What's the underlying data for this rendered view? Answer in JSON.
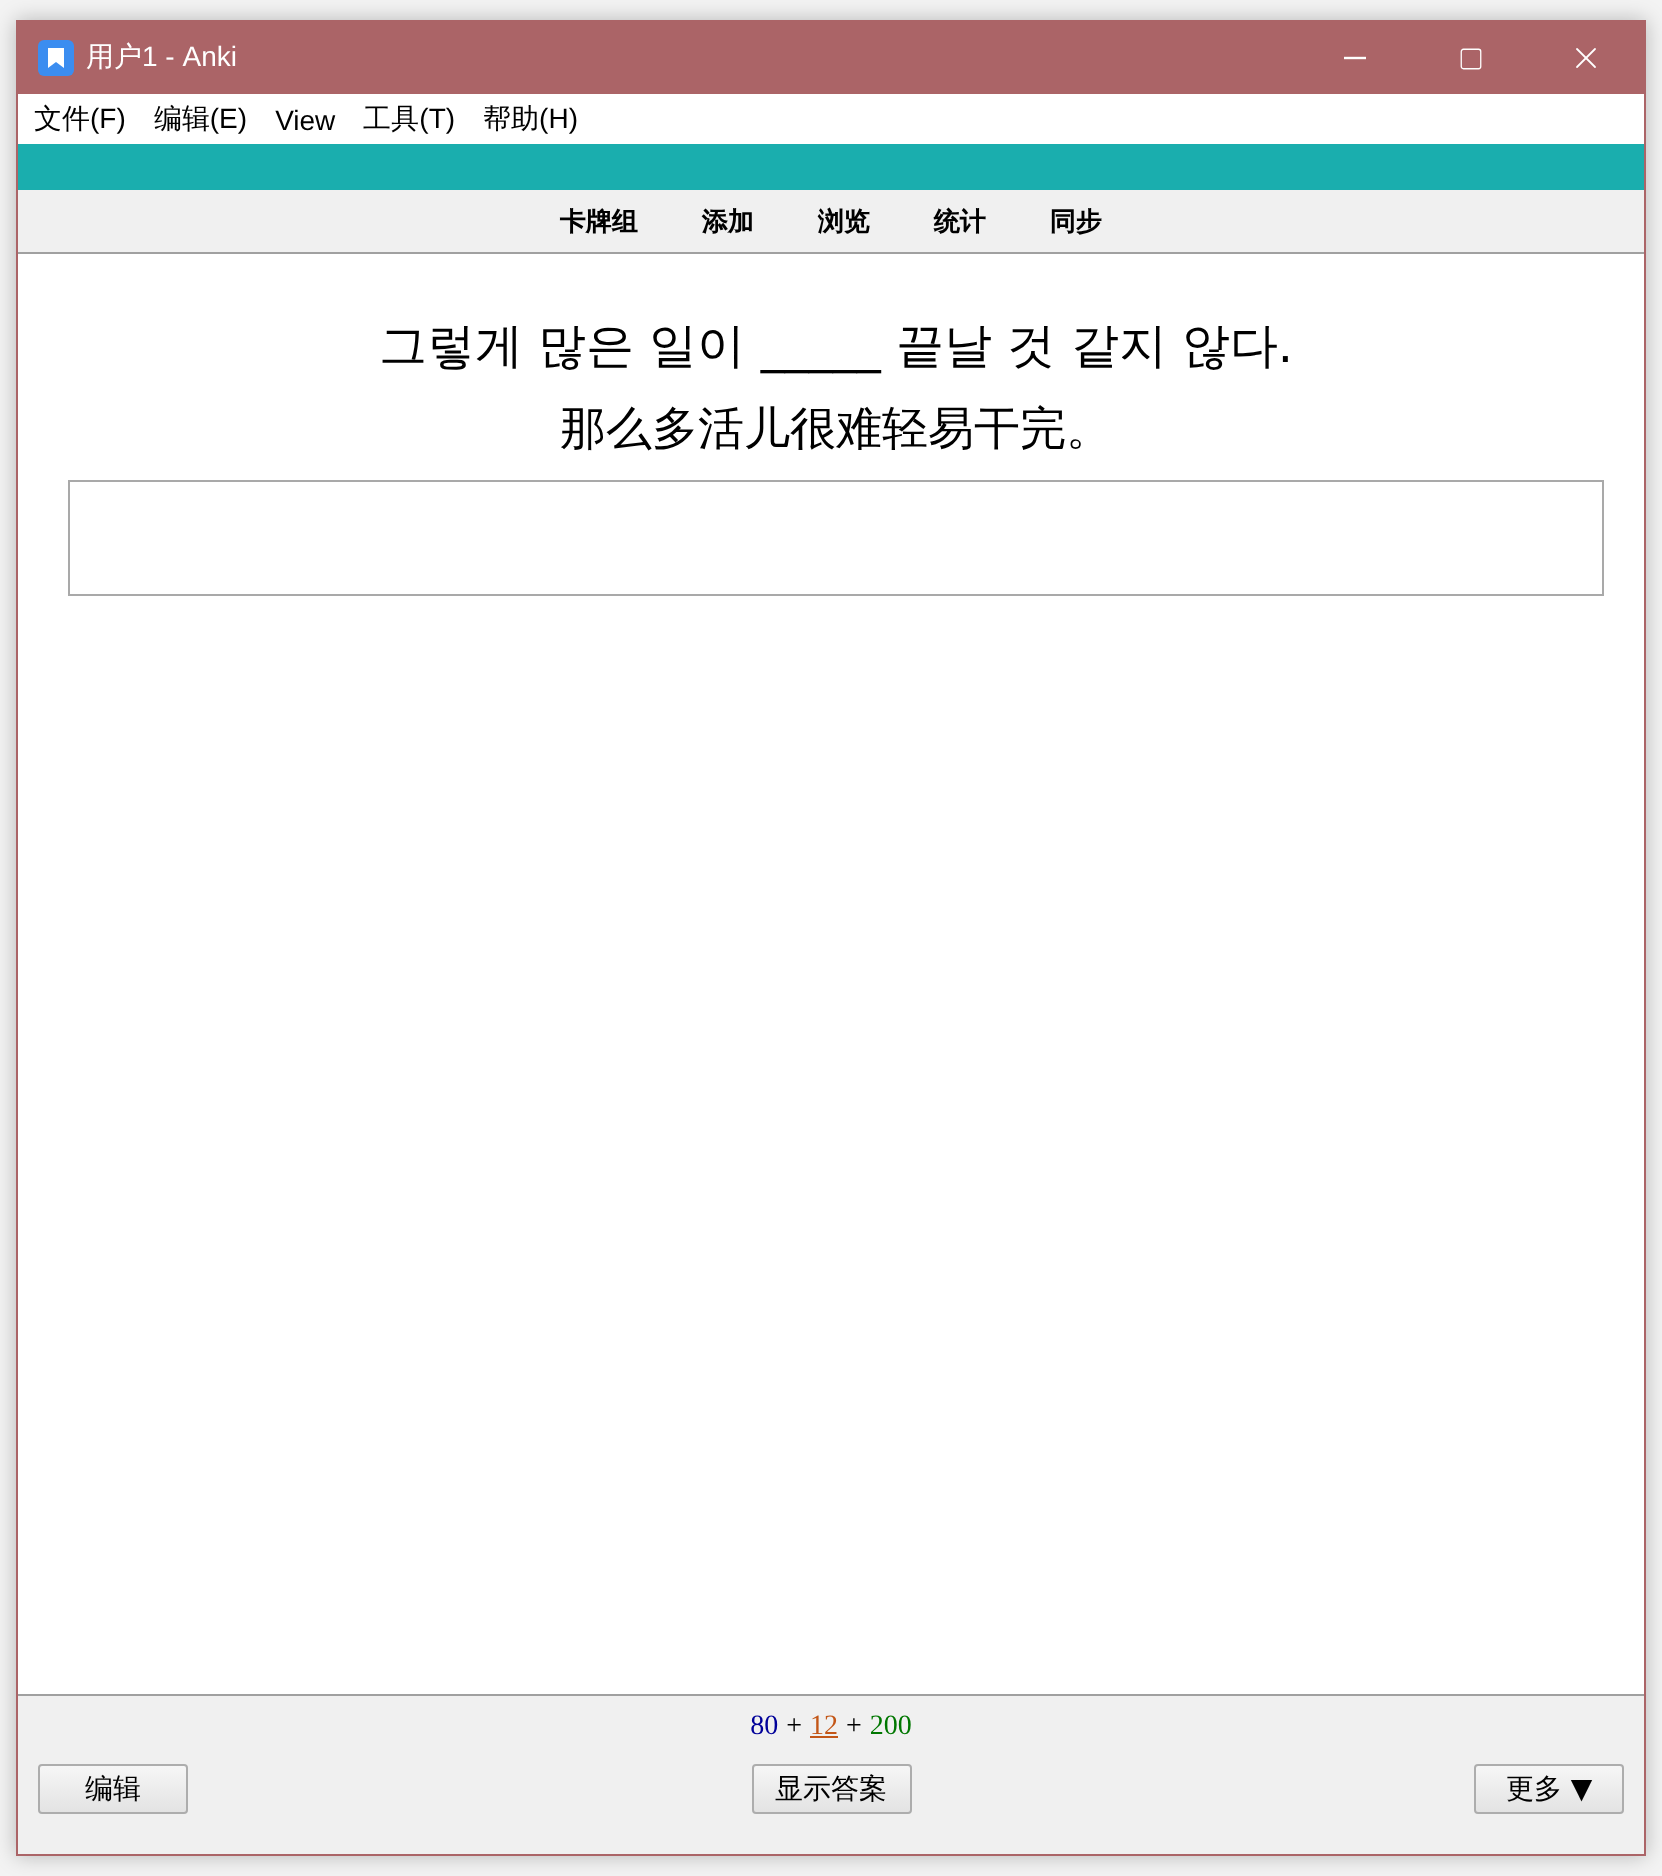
{
  "window": {
    "title": "用户1 - Anki"
  },
  "menu": [
    "文件(F)",
    "编辑(E)",
    "View",
    "工具(T)",
    "帮助(H)"
  ],
  "toolbar": [
    "卡牌组",
    "添加",
    "浏览",
    "统计",
    "同步"
  ],
  "card": {
    "question": "그렇게 많은 일이 _____ 끝날 것 같지 않다.",
    "hint": "那么多活儿很难轻易干完。"
  },
  "counts": [
    {
      "text": "80",
      "color": "#000099",
      "current": false
    },
    {
      "text": "+",
      "color": "#000000",
      "current": false
    },
    {
      "text": "12",
      "color": "#c35617",
      "current": true
    },
    {
      "text": "+",
      "color": "#000000",
      "current": false
    },
    {
      "text": "200",
      "color": "#007700",
      "current": false
    }
  ],
  "bottom_buttons": [
    {
      "label": "编辑",
      "kind": "left"
    },
    {
      "label": "显示答案",
      "kind": "center"
    },
    {
      "label": "更多 ▼",
      "kind": "right"
    }
  ]
}
